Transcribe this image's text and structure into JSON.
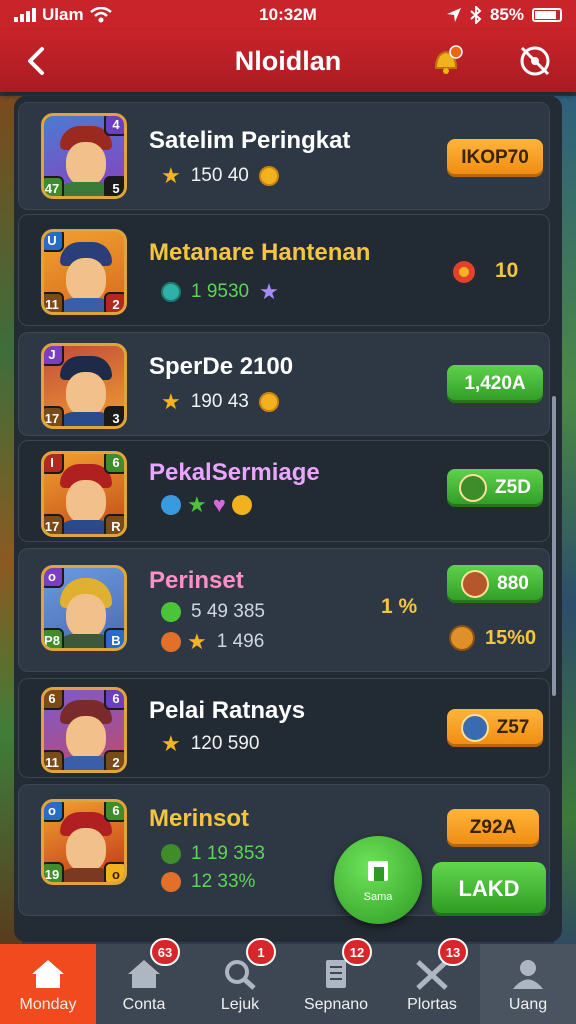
{
  "status_bar": {
    "carrier": "Ulam",
    "time": "10:32M",
    "battery": "85%"
  },
  "header": {
    "title": "Nloidlan"
  },
  "colors": {
    "brand_red": "#c8242a",
    "accent_orange": "#f08a10",
    "accent_green": "#2e9a24"
  },
  "rows": [
    {
      "name": "Satelim Peringkat",
      "name_color": "#ffffff",
      "stat1": "150 40",
      "action": "IKOP70",
      "action_style": "orange"
    },
    {
      "name": "Metanare Hantenan",
      "name_color": "#f2c542",
      "stat1": "1 9530",
      "side_value": "10"
    },
    {
      "name": "SperDe 2100",
      "name_color": "#ffffff",
      "stat1": "190 43",
      "action": "1,420A",
      "action_style": "green"
    },
    {
      "name": "PekalSermiage",
      "name_color": "#e9a6ff",
      "action": "Z5D",
      "action_style": "green"
    },
    {
      "name": "Perinset",
      "name_color": "#ff8fc7",
      "stat1": "5 49 385",
      "stat2": "1 496",
      "side_value": "1 %",
      "action": "880",
      "action_style": "green",
      "action2": "15%0"
    },
    {
      "name": "Pelai Ratnays",
      "name_color": "#ffffff",
      "stat1": "120 590",
      "action": "Z57",
      "action_style": "orange"
    },
    {
      "name": "Merinsot",
      "name_color": "#f2c542",
      "stat1": "1 19 353",
      "stat2": "12 33%",
      "action": "Z92A",
      "action_style": "orange"
    }
  ],
  "fab": {
    "label": "Sama"
  },
  "laker_button": {
    "label": "LAKD"
  },
  "nav": [
    {
      "label": "Monday",
      "badge": "",
      "active": true
    },
    {
      "label": "Conta",
      "badge": "63",
      "active": false
    },
    {
      "label": "Lejuk",
      "badge": "1",
      "active": false
    },
    {
      "label": "Sepnano",
      "badge": "12",
      "active": false
    },
    {
      "label": "Plortas",
      "badge": "13",
      "active": false
    },
    {
      "label": "Uang",
      "badge": "",
      "active": false
    }
  ]
}
